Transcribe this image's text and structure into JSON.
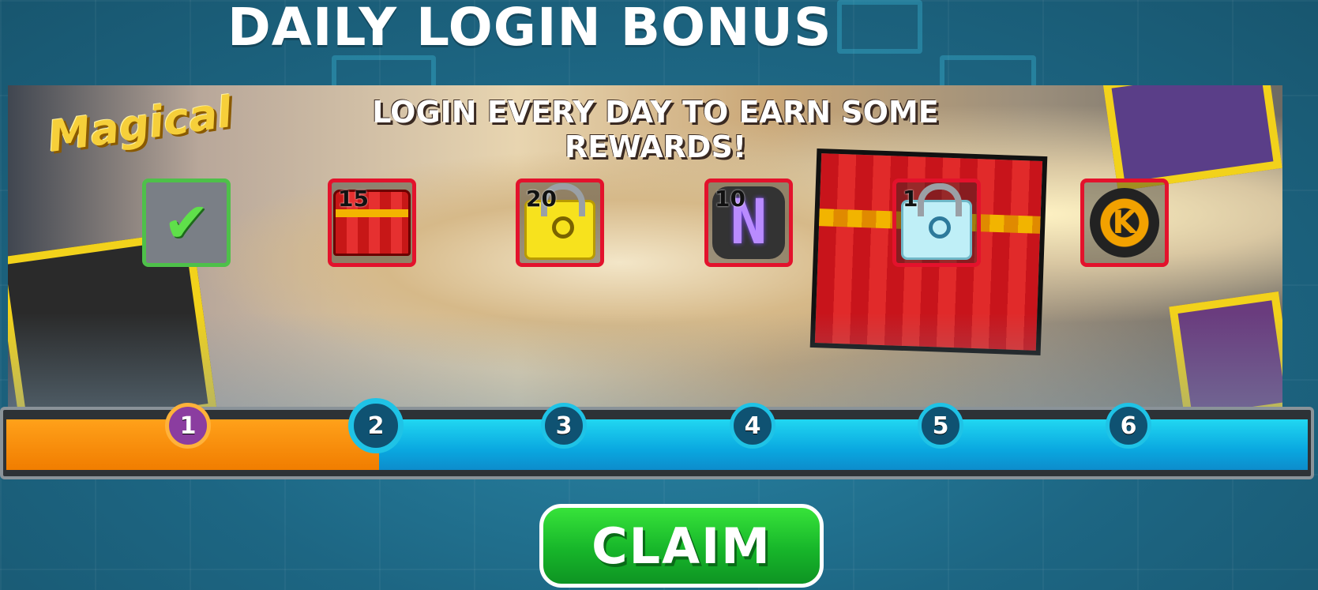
{
  "header": {
    "title": "DAILY LOGIN BONUS"
  },
  "banner": {
    "logo_text": "Magical",
    "message": "LOGIN EVERY DAY TO EARN SOME REWARDS!"
  },
  "rewards": [
    {
      "day": "1",
      "qty": "",
      "icon": "checkmark-icon",
      "status": "claimed"
    },
    {
      "day": "2",
      "qty": "15",
      "icon": "treasure-chest-icon",
      "status": "current"
    },
    {
      "day": "3",
      "qty": "20",
      "icon": "gold-lock-icon",
      "status": "locked"
    },
    {
      "day": "4",
      "qty": "10",
      "icon": "n-block-icon",
      "status": "locked"
    },
    {
      "day": "5",
      "qty": "1",
      "icon": "blue-lock-icon",
      "status": "locked"
    },
    {
      "day": "6",
      "qty": "",
      "icon": "gear-emblem-icon",
      "status": "locked"
    }
  ],
  "progress": {
    "completed_days": 1,
    "total_days": 6
  },
  "claim_button": {
    "label": "CLAIM"
  },
  "colors": {
    "claimed_border": "#4ec04a",
    "reward_border": "#e3122c",
    "progress_orange": "#f17d00",
    "progress_blue": "#0aa8e0",
    "claim_green": "#17b62a"
  }
}
